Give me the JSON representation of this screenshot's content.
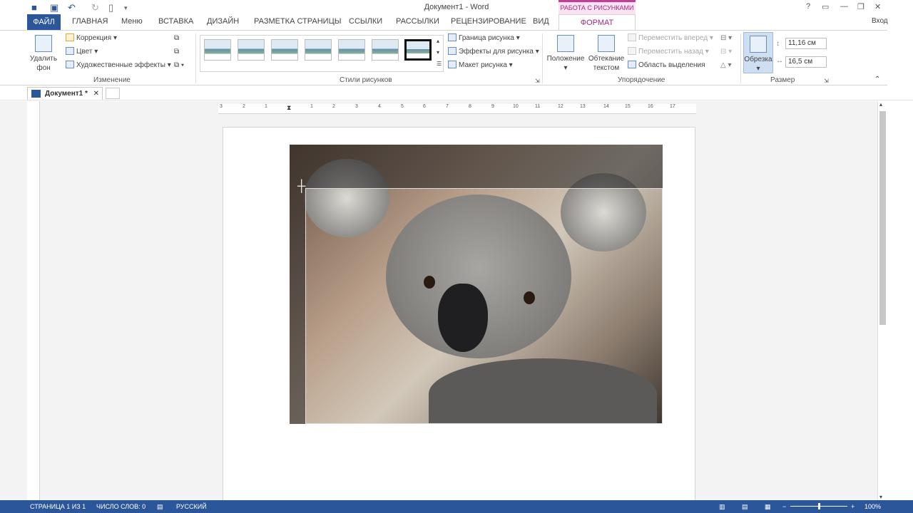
{
  "title_bar": {
    "doc_title": "Документ1 - Word",
    "context_tab_header": "РАБОТА С РИСУНКАМИ",
    "help": "?",
    "signin": "Вход"
  },
  "tabs": {
    "file": "ФАЙЛ",
    "items": [
      "ГЛАВНАЯ",
      "Меню",
      "ВСТАВКА",
      "ДИЗАЙН",
      "РАЗМЕТКА СТРАНИЦЫ",
      "ССЫЛКИ",
      "РАССЫЛКИ",
      "РЕЦЕНЗИРОВАНИЕ",
      "ВИД"
    ],
    "format": "ФОРМАТ"
  },
  "ribbon": {
    "adjust": {
      "remove_bg_1": "Удалить",
      "remove_bg_2": "фон",
      "correction": "Коррекция",
      "color": "Цвет",
      "artistic": "Художественные эффекты",
      "group": "Изменение"
    },
    "styles": {
      "border": "Граница рисунка",
      "effects": "Эффекты для рисунка",
      "layout": "Макет рисунка",
      "group": "Стили рисунков"
    },
    "arrange": {
      "position": "Положение",
      "wrap_1": "Обтекание",
      "wrap_2": "текстом",
      "forward": "Переместить вперед",
      "backward": "Переместить назад",
      "selection": "Область выделения",
      "group": "Упорядочение"
    },
    "size": {
      "crop": "Обрезка",
      "height": "11,16 см",
      "width": "16,5 см",
      "group": "Размер"
    }
  },
  "doc_tab": {
    "name": "Документ1 *",
    "close": "✕"
  },
  "ruler": {
    "marks": [
      "3",
      "2",
      "1",
      "1",
      "2",
      "3",
      "4",
      "5",
      "6",
      "7",
      "8",
      "9",
      "10",
      "11",
      "12",
      "13",
      "14",
      "15",
      "16",
      "17"
    ]
  },
  "status": {
    "page": "СТРАНИЦА 1 ИЗ 1",
    "words": "ЧИСЛО СЛОВ: 0",
    "lang": "РУССКИЙ",
    "zoom": "100%",
    "zoom_minus": "−",
    "zoom_plus": "+"
  },
  "colors": {
    "accent": "#2b579a",
    "context": "#a32b7d"
  }
}
